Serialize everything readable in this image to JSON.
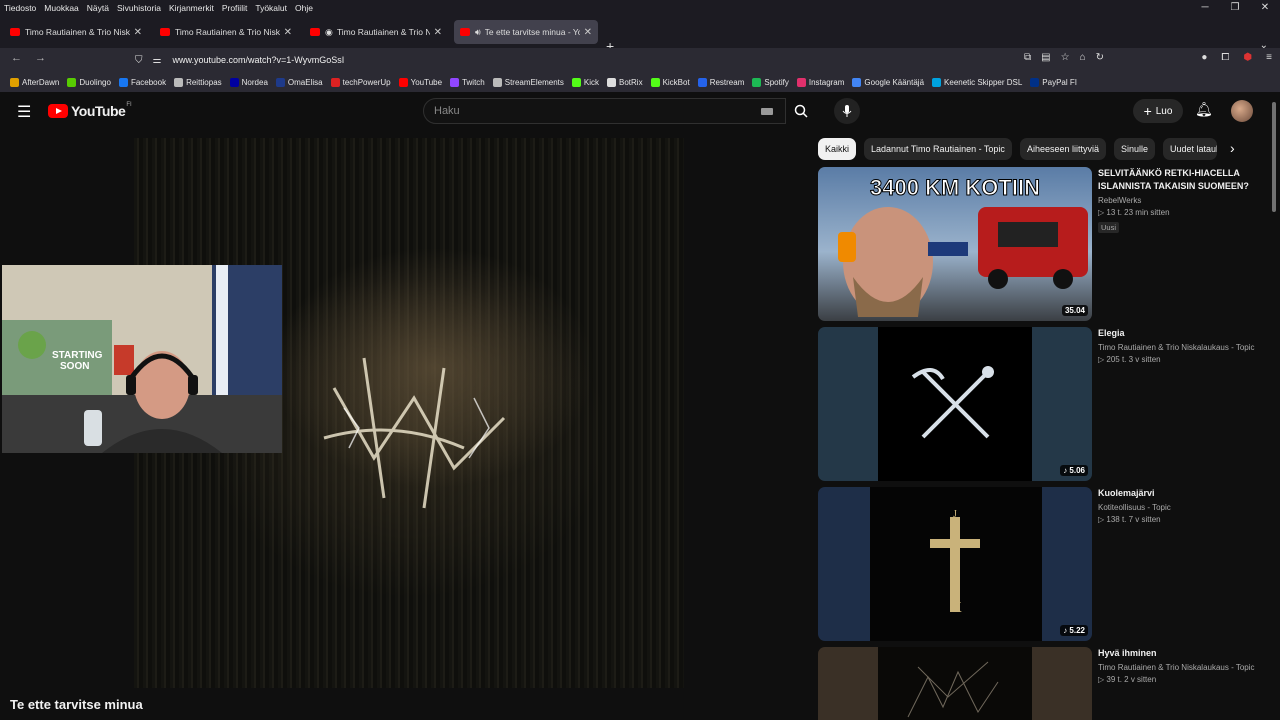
{
  "menubar": [
    "Tiedosto",
    "Muokkaa",
    "Näytä",
    "Sivuhistoria",
    "Kirjanmerkit",
    "Profiilit",
    "Työkalut",
    "Ohje"
  ],
  "tabs": [
    {
      "title": "Timo Rautiainen & Trio Niskalaukaus",
      "active": false
    },
    {
      "title": "Timo Rautiainen & Trio Niskalaukaus",
      "active": false
    },
    {
      "title": "Timo Rautiainen & Trio Niskalaukaus",
      "active": false
    },
    {
      "title": "Te ette tarvitse minua - YouTube",
      "active": true
    }
  ],
  "url": "www.youtube.com/watch?v=1-WyvmGoSsI",
  "bookmarks": [
    {
      "label": "AfterDawn",
      "color": "#e0a000"
    },
    {
      "label": "Duolingo",
      "color": "#58cc02"
    },
    {
      "label": "Facebook",
      "color": "#1877f2"
    },
    {
      "label": "Reittiopas",
      "color": "#bbbbbb"
    },
    {
      "label": "Nordea",
      "color": "#0000a0"
    },
    {
      "label": "OmaElisa",
      "color": "#1e3a8a"
    },
    {
      "label": "techPowerUp",
      "color": "#d22"
    },
    {
      "label": "YouTube",
      "color": "#ff0000"
    },
    {
      "label": "Twitch",
      "color": "#9146ff"
    },
    {
      "label": "StreamElements",
      "color": "#bbbbbb"
    },
    {
      "label": "Kick",
      "color": "#53fc18"
    },
    {
      "label": "BotRix",
      "color": "#dddddd"
    },
    {
      "label": "KickBot",
      "color": "#53fc18"
    },
    {
      "label": "Restream",
      "color": "#2563eb"
    },
    {
      "label": "Spotify",
      "color": "#1db954"
    },
    {
      "label": "Instagram",
      "color": "#e1306c"
    },
    {
      "label": "Google Kääntäjä",
      "color": "#4285f4"
    },
    {
      "label": "Keenetic Skipper DSL",
      "color": "#00a3e0"
    },
    {
      "label": "PayPal FI",
      "color": "#003087"
    }
  ],
  "youtube": {
    "logo_text": "YouTube",
    "region": "FI",
    "search_placeholder": "Haku",
    "create_label": "Luo"
  },
  "video": {
    "title": "Te ette tarvitse minua"
  },
  "chips": [
    "Kaikki",
    "Ladannut Timo Rautiainen - Topic",
    "Aiheeseen liittyviä",
    "Sinulle",
    "Uudet lataukset"
  ],
  "recommendations": [
    {
      "title": "SELVITÄÄNKÖ RETKI-HIACELLA ISLANNISTA TAKAISIN SUOMEEN?",
      "channel": "RebelWerks",
      "meta": "13 t.   23 min sitten",
      "badge": "Uusi",
      "duration": "35.04",
      "thumb_text": "3400 KM KOTIIN"
    },
    {
      "title": "Elegia",
      "channel": "Timo Rautiainen & Trio Niskalaukaus - Topic",
      "meta": "205 t.   3 v sitten",
      "badge": "",
      "duration": "5.06",
      "thumb_text": ""
    },
    {
      "title": "Kuolemajärvi",
      "channel": "Kotiteollisuus - Topic",
      "meta": "138 t.   7 v sitten",
      "badge": "",
      "duration": "5.22",
      "thumb_text": ""
    },
    {
      "title": "Hyvä ihminen",
      "channel": "Timo Rautiainen & Trio Niskalaukaus - Topic",
      "meta": "39 t.   2 v sitten",
      "badge": "",
      "duration": "",
      "thumb_text": ""
    }
  ],
  "webcam": {
    "sign_text_1": "STARTING",
    "sign_text_2": "SOON"
  }
}
